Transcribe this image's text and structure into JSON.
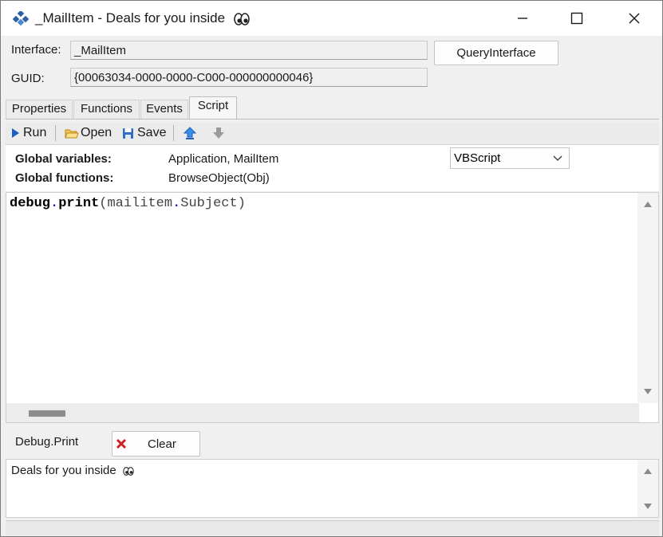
{
  "window": {
    "title": "_MailItem - Deals for you inside",
    "title_emoji": "eyes-emoji"
  },
  "interface": {
    "interface_label": "Interface:",
    "interface_value": "_MailItem",
    "guid_label": "GUID:",
    "guid_value": "{00063034-0000-0000-C000-000000000046}",
    "query_button": "QueryInterface"
  },
  "tabs": [
    {
      "label": "Properties"
    },
    {
      "label": "Functions"
    },
    {
      "label": "Events"
    },
    {
      "label": "Script"
    }
  ],
  "toolbar": {
    "run": "Run",
    "open": "Open",
    "save": "Save"
  },
  "script_info": {
    "globals_vars_label": "Global variables:",
    "globals_vars_value": "Application, MailItem",
    "globals_funcs_label": "Global functions:",
    "globals_funcs_value": "BrowseObject(Obj)",
    "language": "VBScript"
  },
  "editor": {
    "code_obj": "debug",
    "code_dot1": ".",
    "code_fn": "print",
    "code_paren_open": "(",
    "code_arg_obj": "mailitem",
    "code_dot2": ".",
    "code_arg_prop": "Subject",
    "code_paren_close": ")"
  },
  "debug": {
    "label": "Debug.Print",
    "clear_button": "Clear",
    "output": "Deals for you inside"
  },
  "colors": {
    "accent_blue": "#1f5fbf",
    "code_dot": "#0000c0",
    "clear_red": "#d02020"
  }
}
